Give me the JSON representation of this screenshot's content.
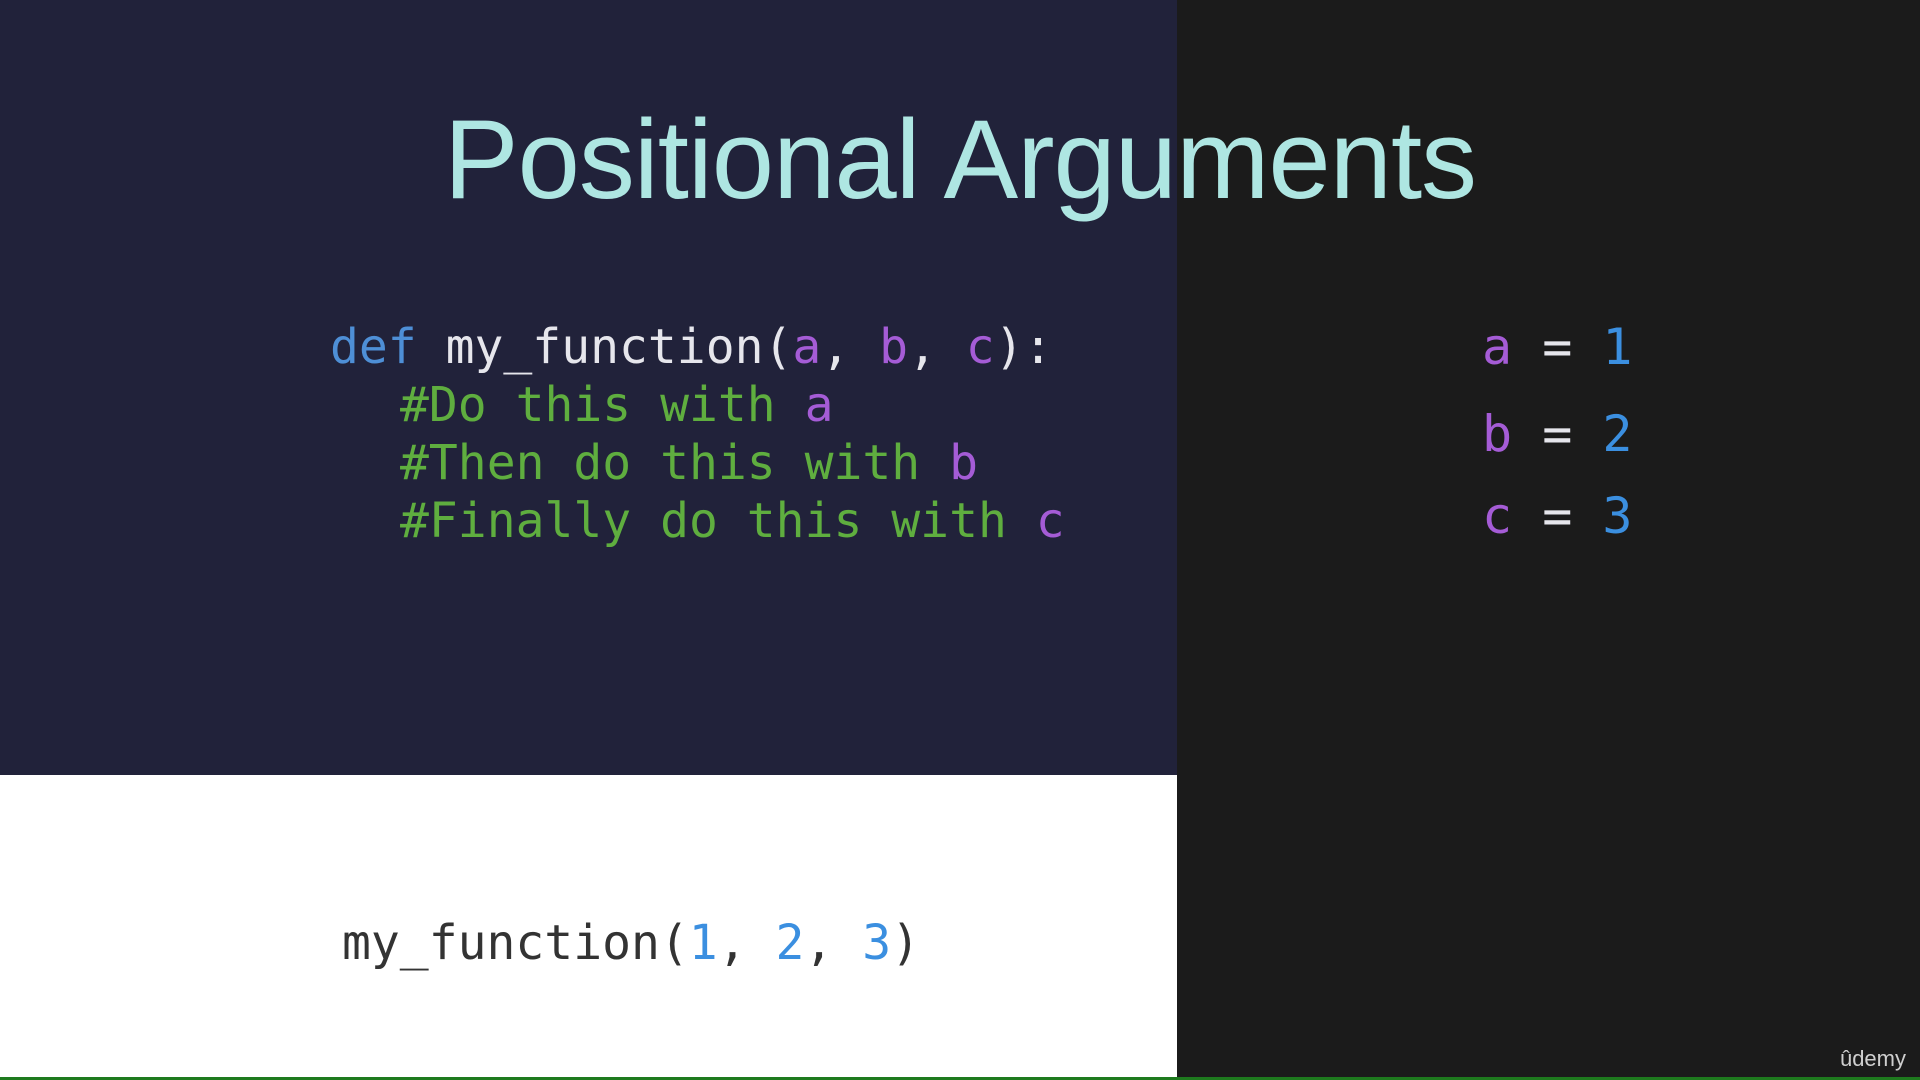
{
  "slide": {
    "title": "Positional Arguments",
    "definition": {
      "keyword": "def",
      "name": "my_function(",
      "param_a": "a",
      "sep1": ", ",
      "param_b": "b",
      "sep2": ", ",
      "param_c": "c",
      "close": "):"
    },
    "comments": [
      {
        "text": "#Do this with ",
        "param": "a"
      },
      {
        "text": "#Then do this with ",
        "param": "b"
      },
      {
        "text": "#Finally do this with ",
        "param": "c"
      }
    ],
    "call": {
      "name": "my_function(",
      "arg1": "1",
      "sep1": ", ",
      "arg2": "2",
      "sep2": ", ",
      "arg3": "3",
      "close": ")"
    },
    "assignments": [
      {
        "var": "a",
        "eq": " = ",
        "val": "1"
      },
      {
        "var": "b",
        "eq": " = ",
        "val": "2"
      },
      {
        "var": "c",
        "eq": " = ",
        "val": "3"
      }
    ],
    "brand": "ûdemy"
  },
  "colors": {
    "title": "#aee6e2",
    "keyword": "#4e8fd6",
    "param": "#a55cd6",
    "comment": "#5fae3f",
    "number": "#3b8fe0",
    "panel_dark_blue": "#21223a",
    "panel_black": "#1b1b1b",
    "panel_white": "#ffffff"
  }
}
